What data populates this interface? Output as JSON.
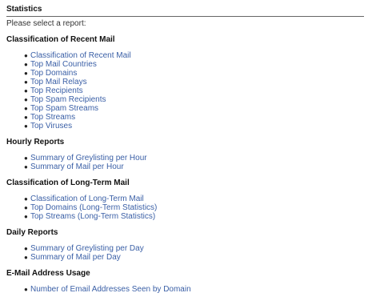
{
  "page": {
    "title": "Statistics",
    "intro": "Please select a report:"
  },
  "sections": [
    {
      "heading": "Classification of Recent Mail",
      "items": [
        "Classification of Recent Mail",
        "Top Mail Countries",
        "Top Domains",
        "Top Mail Relays",
        "Top Recipients",
        "Top Spam Recipients",
        "Top Spam Streams",
        "Top Streams",
        "Top Viruses"
      ]
    },
    {
      "heading": "Hourly Reports",
      "items": [
        "Summary of Greylisting per Hour",
        "Summary of Mail per Hour"
      ]
    },
    {
      "heading": "Classification of Long-Term Mail",
      "items": [
        "Classification of Long-Term Mail",
        "Top Domains (Long-Term Statistics)",
        "Top Streams (Long-Term Statistics)"
      ]
    },
    {
      "heading": "Daily Reports",
      "items": [
        "Summary of Greylisting per Day",
        "Summary of Mail per Day"
      ]
    },
    {
      "heading": "E-Mail Address Usage",
      "items": [
        "Number of Email Addresses Seen by Domain"
      ]
    }
  ],
  "colors": {
    "link": "#3a5fa6",
    "heading": "#111111",
    "rule": "#666666"
  }
}
